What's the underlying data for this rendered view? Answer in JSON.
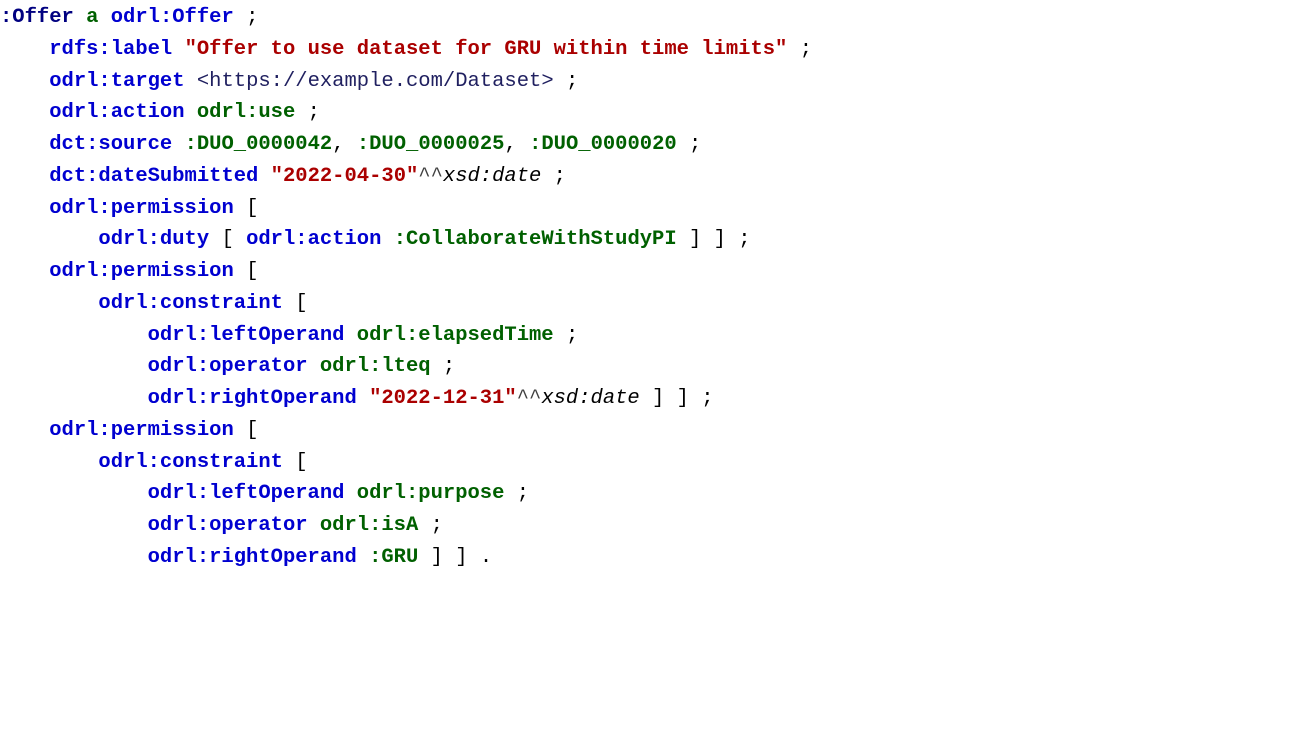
{
  "lines": {
    "l1": {
      "t1": ":Offer",
      "t2": "a",
      "t3": "odrl:Offer",
      "t4": ";"
    },
    "l2": {
      "t1": "rdfs:label",
      "t2": "\"Offer to use dataset for GRU within time limits\"",
      "t3": ";"
    },
    "l3": {
      "t1": "odrl:target",
      "t2": "<https://example.com/Dataset>",
      "t3": ";"
    },
    "l4": {
      "t1": "odrl:action",
      "t2": "odrl:use",
      "t3": ";"
    },
    "l5": {
      "t1": "dct:source",
      "t2": ":DUO_0000042",
      "t3": ",",
      "t4": ":DUO_0000025",
      "t5": ",",
      "t6": ":DUO_0000020",
      "t7": ";"
    },
    "l6": {
      "t1": "dct:dateSubmitted",
      "t2": "\"2022-04-30\"",
      "t3": "^^",
      "t4": "xsd:date",
      "t5": ";"
    },
    "l7": {
      "t1": "odrl:permission",
      "t2": "["
    },
    "l8": {
      "t1": "odrl:duty",
      "t2": "[",
      "t3": "odrl:action",
      "t4": ":CollaborateWithStudyPI",
      "t5": "] ] ;"
    },
    "l9": {
      "t1": "odrl:permission",
      "t2": "["
    },
    "l10": {
      "t1": "odrl:constraint",
      "t2": "["
    },
    "l11": {
      "t1": "odrl:leftOperand",
      "t2": "odrl:elapsedTime",
      "t3": ";"
    },
    "l12": {
      "t1": "odrl:operator",
      "t2": "odrl:lteq",
      "t3": ";"
    },
    "l13": {
      "t1": "odrl:rightOperand",
      "t2": "\"2022-12-31\"",
      "t3": "^^",
      "t4": "xsd:date",
      "t5": "] ] ;"
    },
    "l14": {
      "t1": "odrl:permission",
      "t2": "["
    },
    "l15": {
      "t1": "odrl:constraint",
      "t2": "["
    },
    "l16": {
      "t1": "odrl:leftOperand",
      "t2": "odrl:purpose",
      "t3": ";"
    },
    "l17": {
      "t1": "odrl:operator",
      "t2": "odrl:isA",
      "t3": ";"
    },
    "l18": {
      "t1": "odrl:rightOperand",
      "t2": ":GRU",
      "t3": "] ] ."
    }
  }
}
